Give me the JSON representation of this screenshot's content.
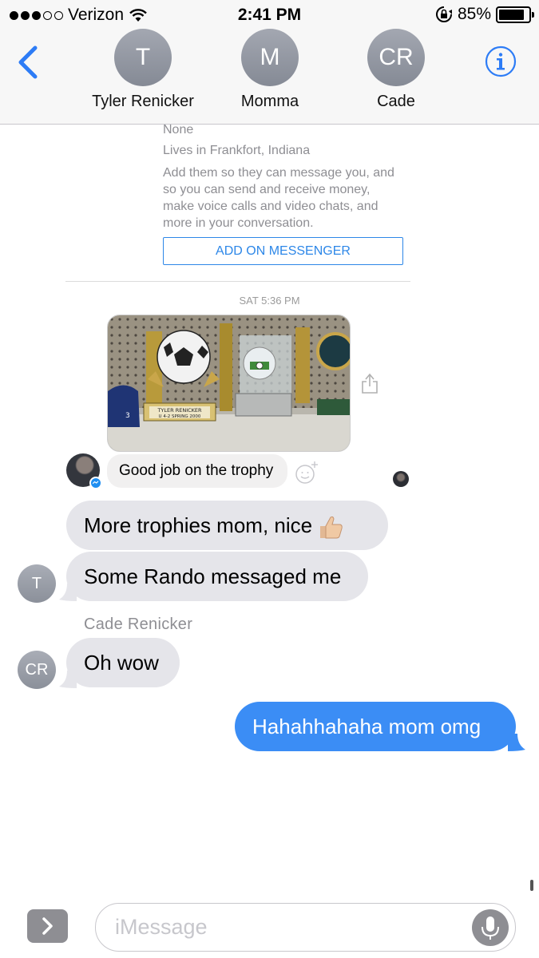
{
  "status_bar": {
    "carrier": "Verizon",
    "time": "2:41 PM",
    "battery": "85%",
    "battery_level": 0.85
  },
  "header": {
    "contacts": [
      {
        "initials": "T",
        "name": "Tyler Renicker"
      },
      {
        "initials": "M",
        "name": "Momma"
      },
      {
        "initials": "CR",
        "name": "Cade"
      }
    ]
  },
  "messenger_card": {
    "line1": "None",
    "line2": "Lives in Frankfort, Indiana",
    "description": "Add them so they can message you, and so you can send and receive money, make voice calls and video chats, and more in your conversation.",
    "add_button": "ADD ON MESSENGER"
  },
  "timestamp": "SAT 5:36 PM",
  "photo": {
    "plate_name": "TYLER RENICKER",
    "plate_detail": "U 4-2  SPRING 2000",
    "helmet_number": "3"
  },
  "fb_message": "Good job on the trophy",
  "messages": [
    {
      "text": "More trophies mom, nice"
    },
    {
      "text": "Some Rando messaged me",
      "avatar": "T"
    },
    {
      "sender": "Cade  Renicker",
      "text": "Oh wow",
      "avatar": "CR"
    },
    {
      "text": "Hahahhahaha mom omg"
    }
  ],
  "composer": {
    "placeholder": "iMessage"
  },
  "colors": {
    "ios_blue": "#3b8df5",
    "incoming_bubble": "#e5e5ea",
    "messenger_blue": "#2d87e8"
  }
}
